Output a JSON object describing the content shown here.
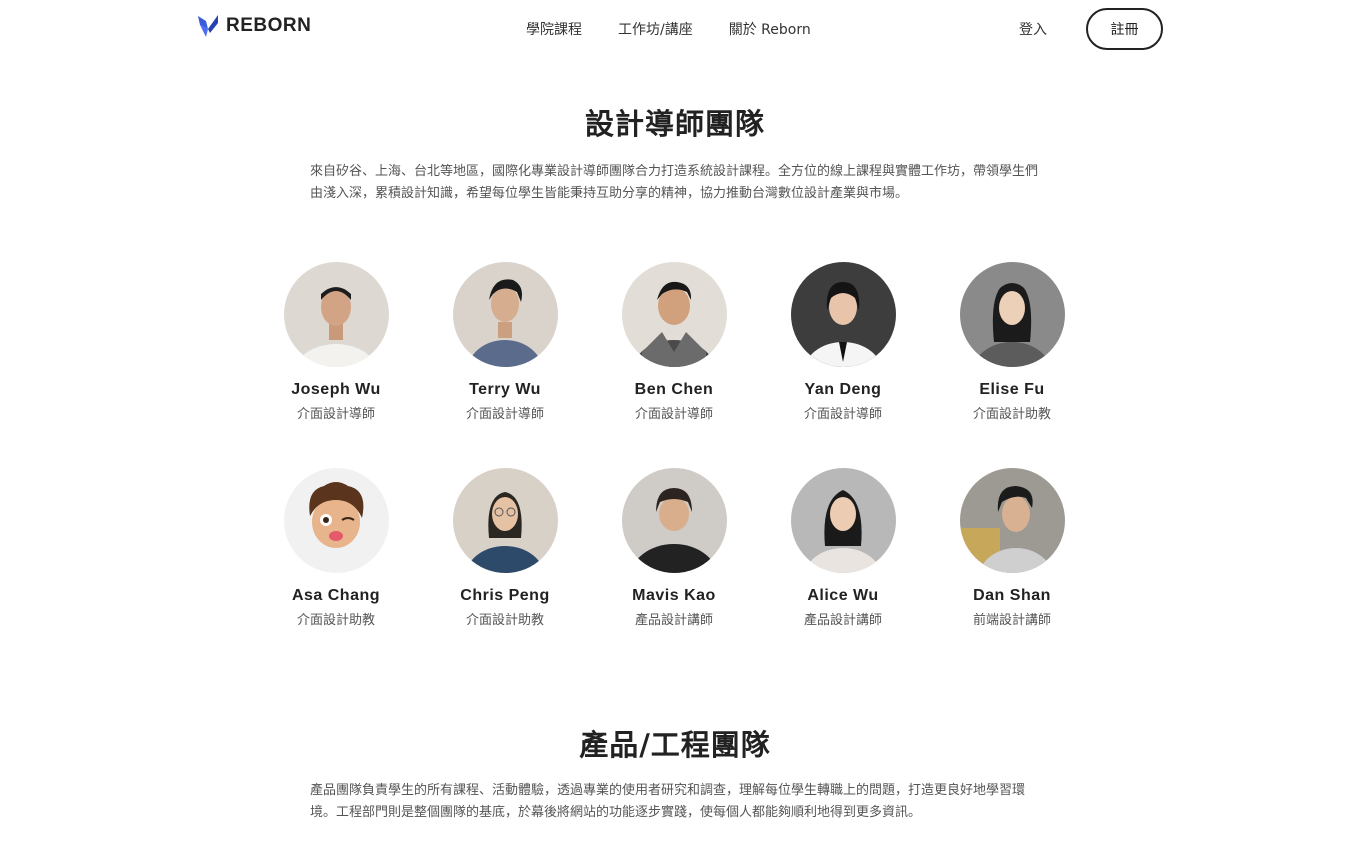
{
  "header": {
    "logo_text": "REBORN",
    "nav": [
      {
        "label": "學院課程"
      },
      {
        "label": "工作坊/講座"
      },
      {
        "label": "關於 Reborn"
      }
    ],
    "login_label": "登入",
    "signup_label": "註冊"
  },
  "design_team": {
    "title": "設計導師團隊",
    "description": "來自矽谷、上海、台北等地區，國際化專業設計導師團隊合力打造系統設計課程。全方位的線上課程與實體工作坊，帶領學生們由淺入深，累積設計知識，希望每位學生皆能秉持互助分享的精神，協力推動台灣數位設計產業與市場。",
    "members": [
      {
        "name": "Joseph Wu",
        "role": "介面設計導師"
      },
      {
        "name": "Terry Wu",
        "role": "介面設計導師"
      },
      {
        "name": "Ben Chen",
        "role": "介面設計導師"
      },
      {
        "name": "Yan Deng",
        "role": "介面設計導師"
      },
      {
        "name": "Elise Fu",
        "role": "介面設計助教"
      },
      {
        "name": "Asa Chang",
        "role": "介面設計助教"
      },
      {
        "name": "Chris Peng",
        "role": "介面設計助教"
      },
      {
        "name": "Mavis Kao",
        "role": "產品設計講師"
      },
      {
        "name": "Alice Wu",
        "role": "產品設計講師"
      },
      {
        "name": "Dan Shan",
        "role": "前端設計講師"
      }
    ]
  },
  "product_team": {
    "title": "產品/工程團隊",
    "description": "產品團隊負責學生的所有課程、活動體驗，透過專業的使用者研究和調查，理解每位學生轉職上的問題，打造更良好地學習環境。工程部門則是整個團隊的基底，於幕後將網站的功能逐步實踐，使每個人都能夠順利地得到更多資訊。"
  },
  "colors": {
    "brand": "#3b5bdb",
    "text_dark": "#222222",
    "text_muted": "#555555"
  }
}
